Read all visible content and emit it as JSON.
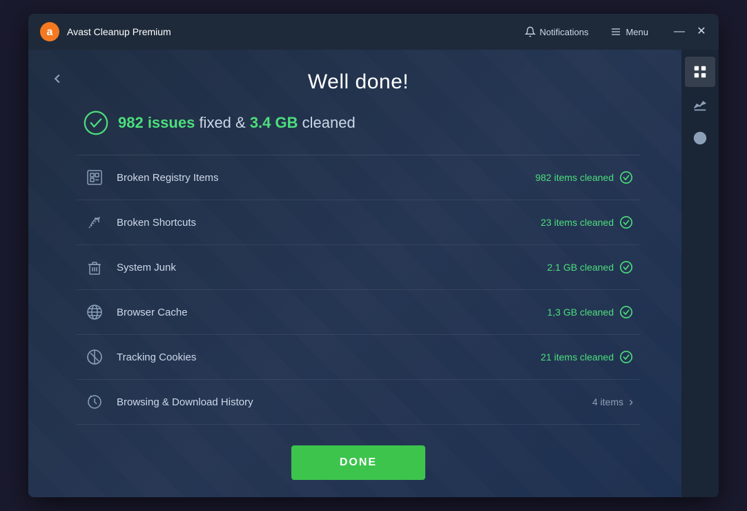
{
  "titlebar": {
    "logo_alt": "Avast logo",
    "title": "Avast Cleanup Premium",
    "notifications_label": "Notifications",
    "menu_label": "Menu",
    "minimize_label": "—",
    "close_label": "✕"
  },
  "page": {
    "title": "Well done!",
    "summary": {
      "issues_count": "982 issues",
      "fixed_text": "fixed &",
      "gb_count": "3.4 GB",
      "cleaned_text": "cleaned"
    }
  },
  "items": [
    {
      "id": "broken-registry",
      "name": "Broken Registry Items",
      "status": "982 items cleaned",
      "type": "check"
    },
    {
      "id": "broken-shortcuts",
      "name": "Broken Shortcuts",
      "status": "23 items cleaned",
      "type": "check"
    },
    {
      "id": "system-junk",
      "name": "System Junk",
      "status": "2.1 GB cleaned",
      "type": "check"
    },
    {
      "id": "browser-cache",
      "name": "Browser Cache",
      "status": "1,3 GB cleaned",
      "type": "check"
    },
    {
      "id": "tracking-cookies",
      "name": "Tracking Cookies",
      "status": "21 items cleaned",
      "type": "check"
    },
    {
      "id": "browsing-history",
      "name": "Browsing & Download History",
      "status": "4 items",
      "type": "arrow"
    }
  ],
  "done_button": "DONE",
  "sidebar_right": {
    "grid_label": "Grid view",
    "chart_label": "Statistics",
    "support_label": "Support"
  }
}
